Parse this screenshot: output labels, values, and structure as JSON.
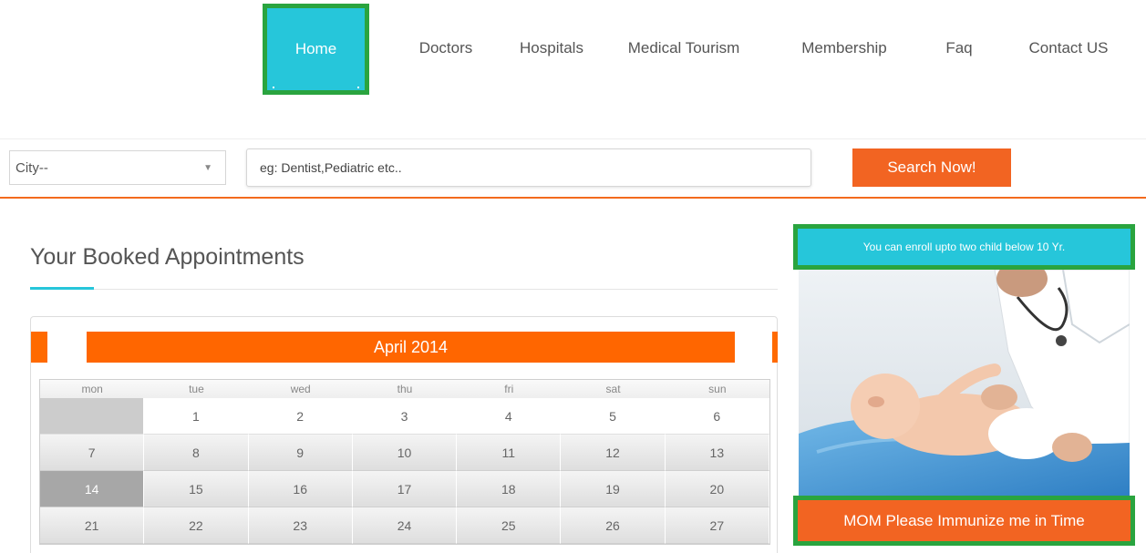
{
  "nav": {
    "items": [
      {
        "label": "Home",
        "active": true
      },
      {
        "label": "Doctors"
      },
      {
        "label": "Hospitals"
      },
      {
        "label": "Medical Tourism"
      },
      {
        "label": "Membership"
      },
      {
        "label": "Faq"
      },
      {
        "label": "Contact US"
      }
    ]
  },
  "search": {
    "city_value": "City--",
    "query_placeholder": "eg: Dentist,Pediatric etc..",
    "button_label": "Search Now!"
  },
  "appointments": {
    "title": "Your Booked Appointments",
    "calendar": {
      "month": "April 2014",
      "weekdays": [
        "mon",
        "tue",
        "wed",
        "thu",
        "fri",
        "sat",
        "sun"
      ],
      "weeks": [
        [
          "",
          "1",
          "2",
          "3",
          "4",
          "5",
          "6"
        ],
        [
          "7",
          "8",
          "9",
          "10",
          "11",
          "12",
          "13"
        ],
        [
          "14",
          "15",
          "16",
          "17",
          "18",
          "19",
          "20"
        ],
        [
          "21",
          "22",
          "23",
          "24",
          "25",
          "26",
          "27"
        ]
      ],
      "highlighted_day": "14"
    }
  },
  "promo": {
    "top_text": "You can enroll upto two child below 10 Yr.",
    "bottom_text": "MOM Please Immunize me in Time"
  },
  "colors": {
    "accent_teal": "#26c6da",
    "accent_orange": "#f26422",
    "highlight_green": "#2aa43f"
  }
}
